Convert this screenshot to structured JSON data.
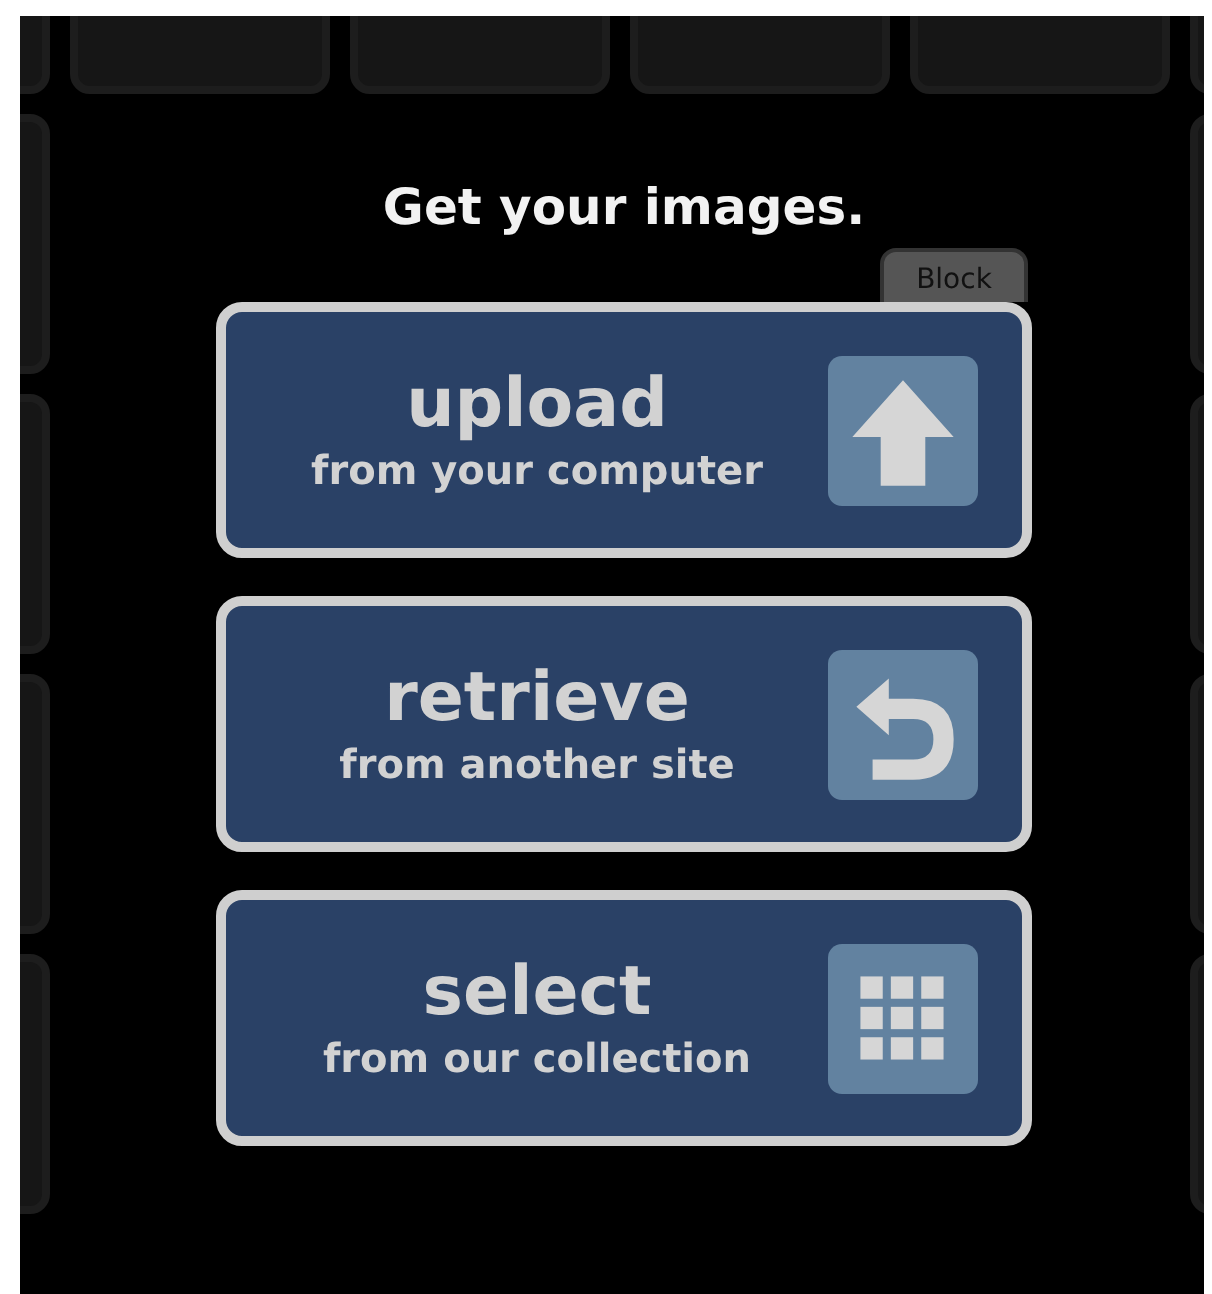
{
  "heading": "Get your images.",
  "corner_tab": {
    "label": "Block"
  },
  "options": [
    {
      "kind": "upload",
      "title": "upload",
      "subtitle": "from your computer"
    },
    {
      "kind": "retrieve",
      "title": "retrieve",
      "subtitle": "from another site"
    },
    {
      "kind": "select",
      "title": "select",
      "subtitle": "from our collection"
    }
  ]
}
